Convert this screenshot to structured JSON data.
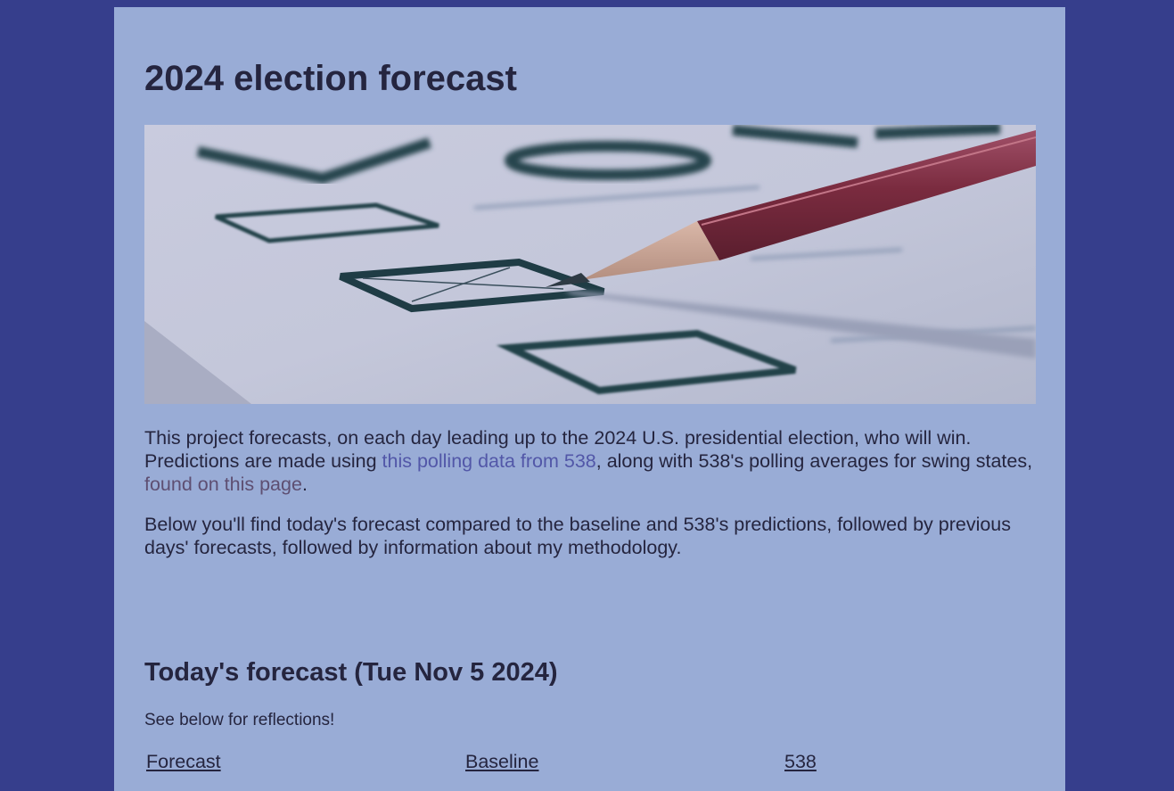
{
  "page": {
    "title": "2024 election forecast"
  },
  "intro": {
    "p1_before": "This project forecasts, on each day leading up to the 2024 U.S. presidential election, who will win. Predictions are made using ",
    "p1_link1": "this polling data from 538",
    "p1_middle": ", along with 538's polling averages for swing states, ",
    "p1_link2": "found on this page",
    "p1_after": ".",
    "p2": "Below you'll find today's forecast compared to the baseline and 538's predictions, followed by previous days' forecasts, followed by information about my methodology."
  },
  "today": {
    "heading": "Today's forecast (Tue Nov 5 2024)",
    "note": "See below for reflections!"
  },
  "tabs": [
    {
      "label": "Forecast"
    },
    {
      "label": "Baseline"
    },
    {
      "label": "538"
    }
  ]
}
